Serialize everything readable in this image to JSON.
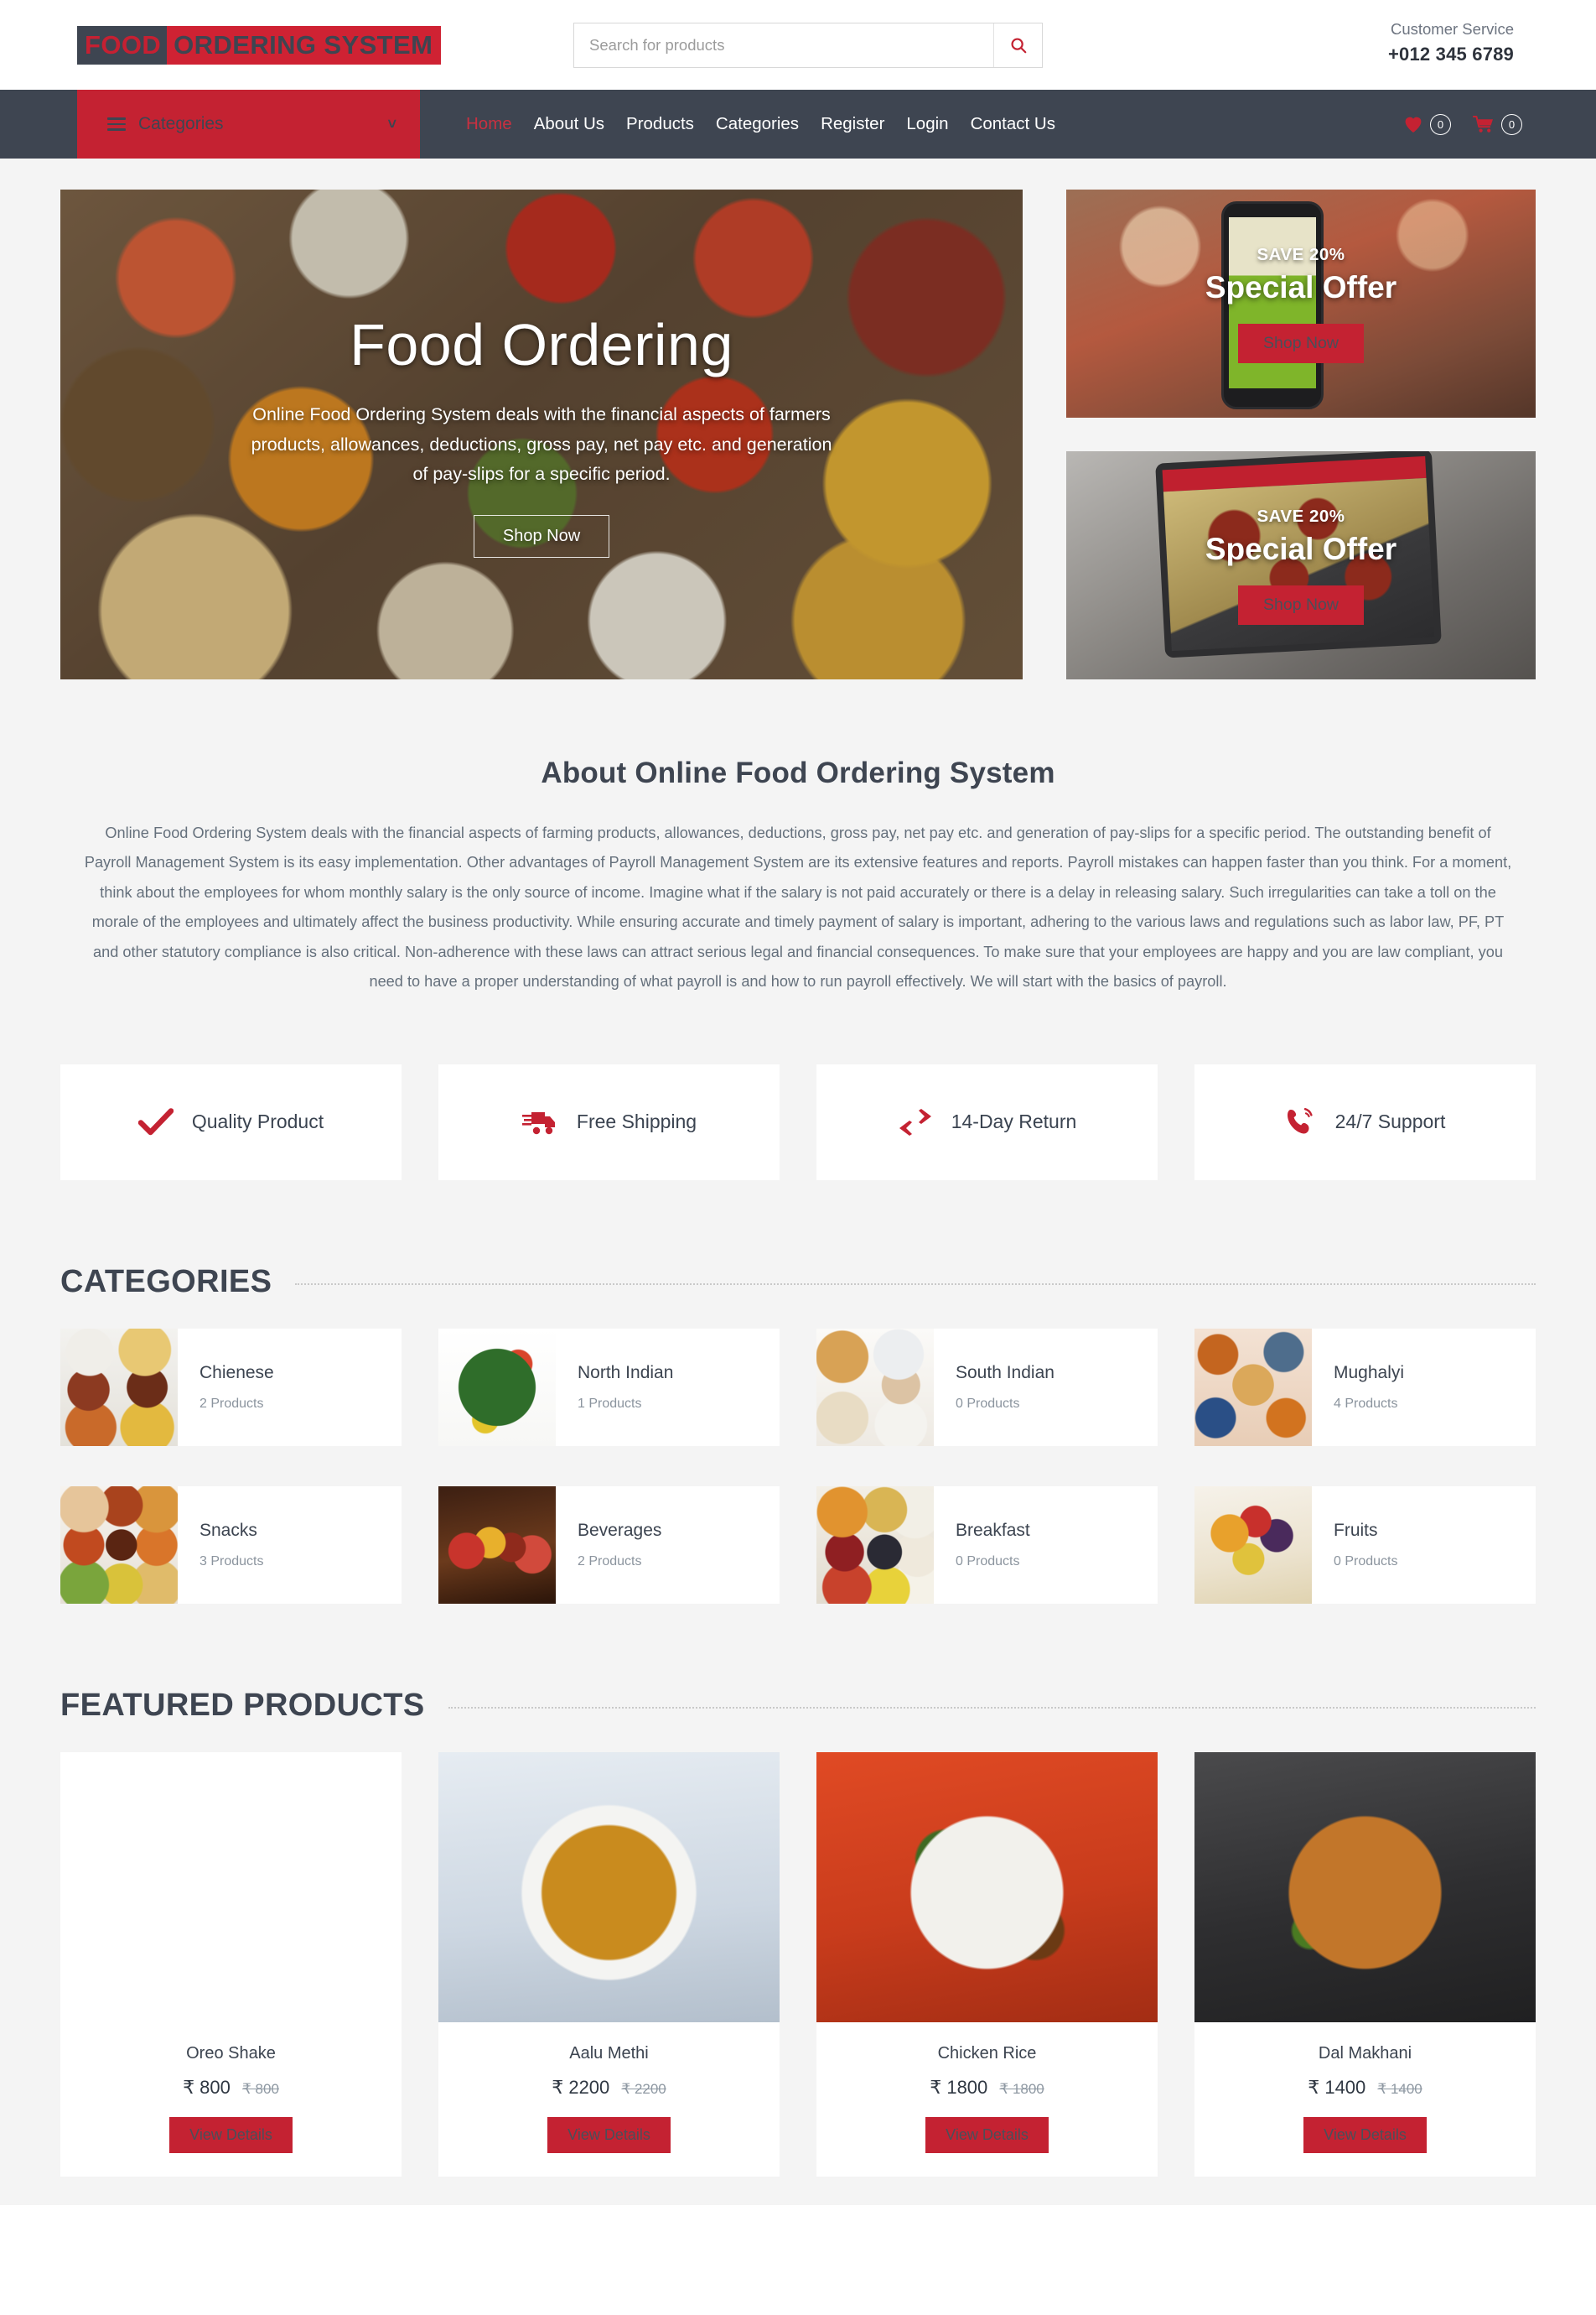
{
  "brand": {
    "logo_part1": "FOOD",
    "logo_part2": "ORDERING SYSTEM",
    "accent_red": "#c42232",
    "dark_slate": "#3e4551"
  },
  "header": {
    "search_placeholder": "Search for products",
    "search_value": "",
    "search_icon": "search-icon",
    "customer_service_label": "Customer Service",
    "customer_service_phone": "+012 345 6789"
  },
  "navbar": {
    "categories_label": "Categories",
    "categories_icon": "hamburger-icon",
    "categories_chevron": "chevron-down-icon",
    "links": [
      {
        "label": "Home",
        "active": true
      },
      {
        "label": "About Us",
        "active": false
      },
      {
        "label": "Products",
        "active": false
      },
      {
        "label": "Categories",
        "active": false
      },
      {
        "label": "Register",
        "active": false
      },
      {
        "label": "Login",
        "active": false
      },
      {
        "label": "Contact Us",
        "active": false
      }
    ],
    "wishlist_icon": "heart-icon",
    "wishlist_count": "0",
    "cart_icon": "cart-icon",
    "cart_count": "0"
  },
  "hero": {
    "title": "Food Ordering",
    "description": "Online Food Ordering System deals with the financial aspects of farmers products, allowances, deductions, gross pay, net pay etc. and generation of pay-slips for a specific period.",
    "cta": "Shop Now"
  },
  "promos": [
    {
      "save": "SAVE 20%",
      "title": "Special Offer",
      "cta": "Shop Now"
    },
    {
      "save": "SAVE 20%",
      "title": "Special Offer",
      "cta": "Shop Now"
    }
  ],
  "about": {
    "heading": "About Online Food Ordering System",
    "body": "Online Food Ordering System deals with the financial aspects of farming products, allowances, deductions, gross pay, net pay etc. and generation of pay-slips for a specific period. The outstanding benefit of Payroll Management System is its easy implementation. Other advantages of Payroll Management System are its extensive features and reports. Payroll mistakes can happen faster than you think. For a moment, think about the employees for whom monthly salary is the only source of income. Imagine what if the salary is not paid accurately or there is a delay in releasing salary. Such irregularities can take a toll on the morale of the employees and ultimately affect the business productivity. While ensuring accurate and timely payment of salary is important, adhering to the various laws and regulations such as labor law, PF, PT and other statutory compliance is also critical. Non-adherence with these laws can attract serious legal and financial consequences. To make sure that your employees are happy and you are law compliant, you need to have a proper understanding of what payroll is and how to run payroll effectively. We will start with the basics of payroll."
  },
  "features": [
    {
      "label": "Quality Product",
      "icon": "check-icon"
    },
    {
      "label": "Free Shipping",
      "icon": "truck-icon"
    },
    {
      "label": "14-Day Return",
      "icon": "exchange-arrows-icon"
    },
    {
      "label": "24/7 Support",
      "icon": "phone-ringing-icon"
    }
  ],
  "categories_section": {
    "heading": "CATEGORIES",
    "items": [
      {
        "name": "Chienese",
        "count": "2 Products",
        "img": "img-chienese"
      },
      {
        "name": "North Indian",
        "count": "1 Products",
        "img": "img-north"
      },
      {
        "name": "South Indian",
        "count": "0 Products",
        "img": "img-south"
      },
      {
        "name": "Mughalyi",
        "count": "4 Products",
        "img": "img-mughalyi"
      },
      {
        "name": "Snacks",
        "count": "3 Products",
        "img": "img-snacks"
      },
      {
        "name": "Beverages",
        "count": "2 Products",
        "img": "img-bev"
      },
      {
        "name": "Breakfast",
        "count": "0 Products",
        "img": "img-breakfast"
      },
      {
        "name": "Fruits",
        "count": "0 Products",
        "img": "img-fruits"
      }
    ]
  },
  "featured_section": {
    "heading": "FEATURED PRODUCTS",
    "button_label": "View Details",
    "items": [
      {
        "name": "Oreo Shake",
        "price": "₹ 800",
        "old_price": "₹ 800",
        "img": "img-oreo"
      },
      {
        "name": "Aalu Methi",
        "price": "₹ 2200",
        "old_price": "₹ 2200",
        "img": "img-aalu"
      },
      {
        "name": "Chicken Rice",
        "price": "₹ 1800",
        "old_price": "₹ 1800",
        "img": "img-chickenrice"
      },
      {
        "name": "Dal Makhani",
        "price": "₹ 1400",
        "old_price": "₹ 1400",
        "img": "img-dal"
      }
    ]
  }
}
